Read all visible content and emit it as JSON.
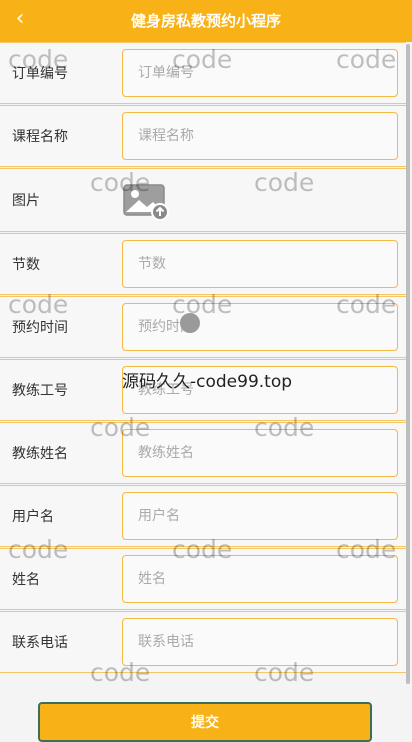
{
  "navbar": {
    "title": "健身房私教预约小程序",
    "back_icon": "chevron-left-icon",
    "back_glyph": "‹"
  },
  "form": {
    "fields": [
      {
        "label": "订单编号",
        "placeholder": "订单编号"
      },
      {
        "label": "课程名称",
        "placeholder": "课程名称"
      },
      {
        "label": "图片",
        "type": "image-upload",
        "icon": "image-upload-icon"
      },
      {
        "label": "节数",
        "placeholder": "节数"
      },
      {
        "label": "预约时间",
        "placeholder": "预约时间"
      },
      {
        "label": "教练工号",
        "placeholder": "教练工号"
      },
      {
        "label": "教练姓名",
        "placeholder": "教练姓名"
      },
      {
        "label": "用户名",
        "placeholder": "用户名"
      },
      {
        "label": "姓名",
        "placeholder": "姓名"
      },
      {
        "label": "联系电话",
        "placeholder": "联系电话"
      }
    ],
    "submit_label": "提交"
  },
  "watermark": {
    "text": "code",
    "center_text": "源码久久-code99.top"
  },
  "colors": {
    "accent": "#f8b116",
    "border": "#f6c766",
    "submit_border": "#3c6e5b"
  }
}
